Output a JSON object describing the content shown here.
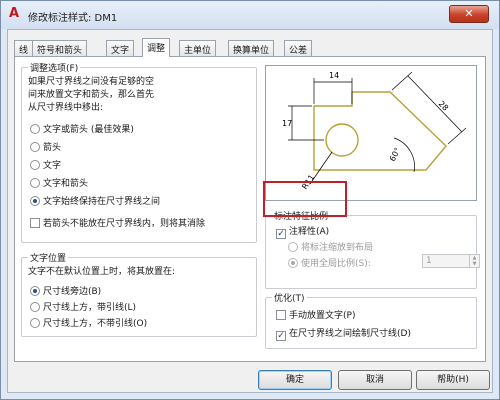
{
  "window": {
    "title": "修改标注样式: DM1",
    "close_glyph": "✕",
    "logo_glyph": "A"
  },
  "tabs": [
    {
      "label": "线",
      "active": false
    },
    {
      "label": "符号和箭头",
      "active": false
    },
    {
      "label": "文字",
      "active": false
    },
    {
      "label": "调整",
      "active": true
    },
    {
      "label": "主单位",
      "active": false
    },
    {
      "label": "换算单位",
      "active": false
    },
    {
      "label": "公差",
      "active": false
    }
  ],
  "fit_options": {
    "legend": "调整选项(F)",
    "description": [
      "如果尺寸界线之间没有足够的空",
      "间来放置文字和箭头，那么首先",
      "从尺寸界线中移出:"
    ],
    "options": [
      {
        "label": "文字或箭头 (最佳效果)",
        "selected": false
      },
      {
        "label": "箭头",
        "selected": false
      },
      {
        "label": "文字",
        "selected": false
      },
      {
        "label": "文字和箭头",
        "selected": false
      },
      {
        "label": "文字始终保持在尺寸界线之间",
        "selected": true
      }
    ],
    "suppress_arrows": {
      "label": "若箭头不能放在尺寸界线内，则将其消除",
      "checked": false
    }
  },
  "text_placement": {
    "legend": "文字位置",
    "description": "文字不在默认位置上时，将其放置在:",
    "options": [
      {
        "label": "尺寸线旁边(B)",
        "selected": true
      },
      {
        "label": "尺寸线上方，带引线(L)",
        "selected": false
      },
      {
        "label": "尺寸线上方，不带引线(O)",
        "selected": false
      }
    ]
  },
  "preview": {
    "dim_top": "14",
    "dim_left": "17",
    "dim_diagonal": "28",
    "dim_radius": "R11",
    "dim_angle": "60°"
  },
  "scale": {
    "legend": "标注特征比例",
    "annotative": {
      "label": "注释性(A)",
      "checked": true
    },
    "scale_to_layout": {
      "label": "将标注缩放到布局",
      "selected": false
    },
    "overall_scale": {
      "label": "使用全局比例(S):",
      "selected": true,
      "value": "1"
    }
  },
  "fine_tuning": {
    "legend": "优化(T)",
    "manual_text": {
      "label": "手动放置文字(P)",
      "checked": false
    },
    "draw_dim_line": {
      "label": "在尺寸界线之间绘制尺寸线(D)",
      "checked": true
    }
  },
  "buttons": {
    "ok": "确定",
    "cancel": "取消",
    "help": "帮助(H)"
  },
  "colors": {
    "preview_outline": "#b8a234",
    "dimension_lines": "#000000",
    "highlight_box": "#c0202a"
  }
}
